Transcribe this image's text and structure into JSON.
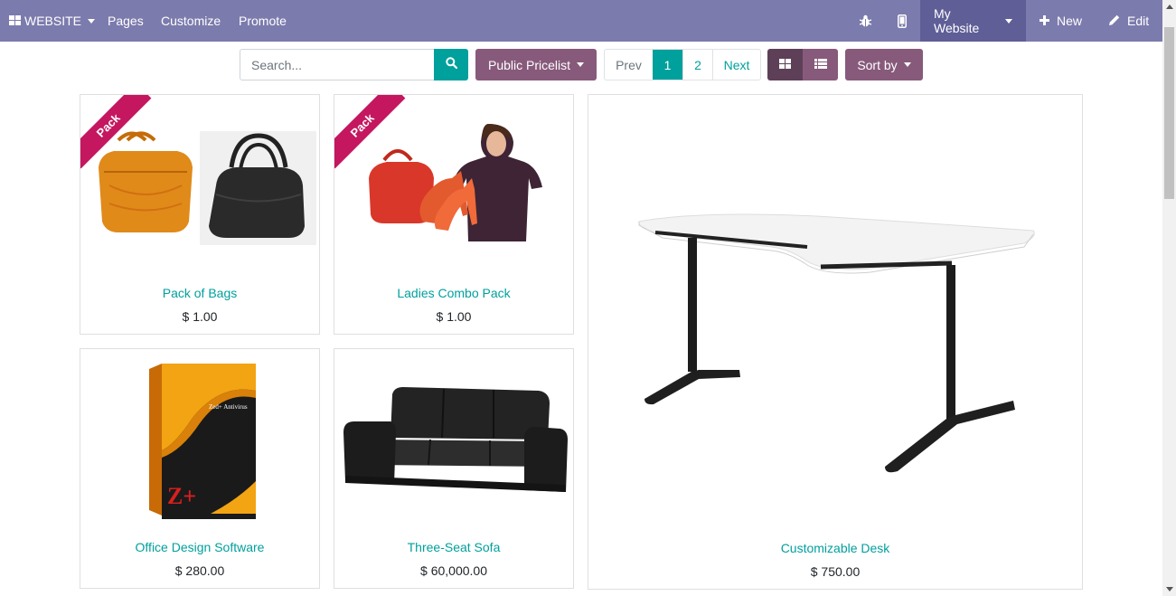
{
  "topbar": {
    "website_label": "WEBSITE",
    "menu": [
      "Pages",
      "Customize",
      "Promote"
    ],
    "my_website_label": "My Website",
    "new_label": "New",
    "edit_label": "Edit"
  },
  "search": {
    "placeholder": "Search..."
  },
  "pricelist_label": "Public Pricelist",
  "pager": {
    "prev": "Prev",
    "pages": [
      "1",
      "2"
    ],
    "next": "Next"
  },
  "sort_label": "Sort by",
  "products": [
    {
      "name": "Pack of Bags",
      "price": "$ 1.00",
      "ribbon": "Pack"
    },
    {
      "name": "Ladies Combo Pack",
      "price": "$ 1.00",
      "ribbon": "Pack"
    },
    {
      "name": "Customizable Desk",
      "price": "$ 750.00"
    },
    {
      "name": "Office Design Software",
      "price": "$ 280.00",
      "box_text": "Zed+ Antivirus",
      "box_logo": "Z+"
    },
    {
      "name": "Three-Seat Sofa",
      "price": "$ 60,000.00"
    }
  ],
  "colors": {
    "topbar": "#7c7bad",
    "accent": "#00a09d",
    "secondary": "#875a7b",
    "ribbon": "#c4175f"
  }
}
